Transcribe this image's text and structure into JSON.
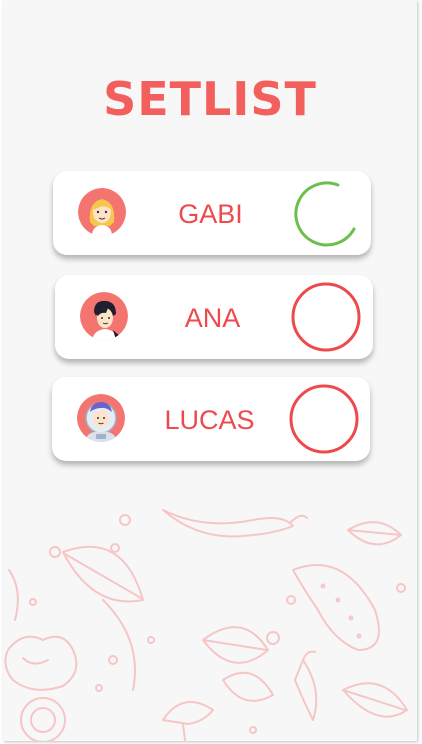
{
  "app": {
    "title": "SETLIST"
  },
  "members": [
    {
      "name": "GABI",
      "avatar": "avatar-blonde-girl-icon",
      "status": "in-progress"
    },
    {
      "name": "ANA",
      "avatar": "avatar-dark-hair-icon",
      "status": "pending"
    },
    {
      "name": "LUCAS",
      "avatar": "avatar-astronaut-icon",
      "status": "pending"
    }
  ],
  "colors": {
    "accent": "#f25f5c",
    "name_text": "#ee4a4d",
    "pending_ring": "#ee4a4d",
    "progress_ring": "#6cbf4a",
    "background": "#f8f7f7",
    "pattern": "#f6c6c6"
  }
}
